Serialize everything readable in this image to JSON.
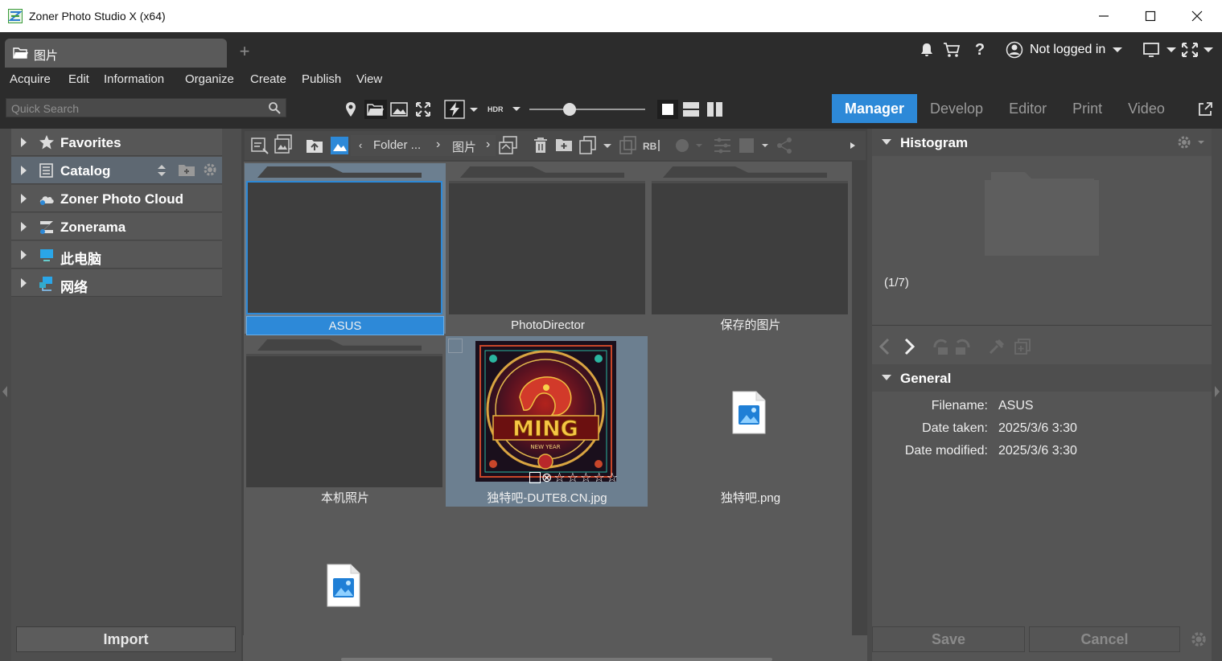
{
  "window": {
    "title": "Zoner Photo Studio X (x64)"
  },
  "tabs": {
    "active_label": "图片"
  },
  "account": {
    "status": "Not logged in"
  },
  "menu": [
    "Acquire",
    "Edit",
    "Information",
    "Organize",
    "Create",
    "Publish",
    "View"
  ],
  "search": {
    "placeholder": "Quick Search"
  },
  "toolbar": {
    "hdr_label": "HDR"
  },
  "modes": [
    "Manager",
    "Develop",
    "Editor",
    "Print",
    "Video"
  ],
  "navigator": {
    "items": [
      {
        "label": "Favorites",
        "icon": "star-icon"
      },
      {
        "label": "Catalog",
        "icon": "catalog-icon"
      },
      {
        "label": "Zoner Photo Cloud",
        "icon": "cloud-icon"
      },
      {
        "label": "Zonerama",
        "icon": "zonerama-icon"
      },
      {
        "label": "此电脑",
        "icon": "computer-icon"
      },
      {
        "label": "网络",
        "icon": "network-icon"
      }
    ],
    "import_label": "Import"
  },
  "breadcrumb": {
    "folder": "Folder ...",
    "current": "图片"
  },
  "browser": {
    "items": [
      {
        "name": "ASUS",
        "type": "folder"
      },
      {
        "name": "PhotoDirector",
        "type": "folder"
      },
      {
        "name": "保存的图片",
        "type": "folder"
      },
      {
        "name": "本机照片",
        "type": "folder"
      },
      {
        "name": "独特吧-DUTE8.CN.jpg",
        "type": "image"
      },
      {
        "name": "独特吧.png",
        "type": "image-file"
      },
      {
        "name": "",
        "type": "image-file"
      }
    ],
    "thumb_text": "MING",
    "thumb_subtext": "NEW YEAR"
  },
  "right_panel": {
    "histogram_title": "Histogram",
    "counter": "(1/7)",
    "general_title": "General",
    "fields": [
      {
        "key": "Filename:",
        "value": "ASUS"
      },
      {
        "key": "Date taken:",
        "value": "2025/3/6 3:30"
      },
      {
        "key": "Date modified:",
        "value": "2025/3/6 3:30"
      }
    ],
    "save_label": "Save",
    "cancel_label": "Cancel"
  },
  "colors": {
    "accent": "#2d89d8",
    "panel": "#4a4a4a",
    "dark": "#2c2c2c"
  }
}
